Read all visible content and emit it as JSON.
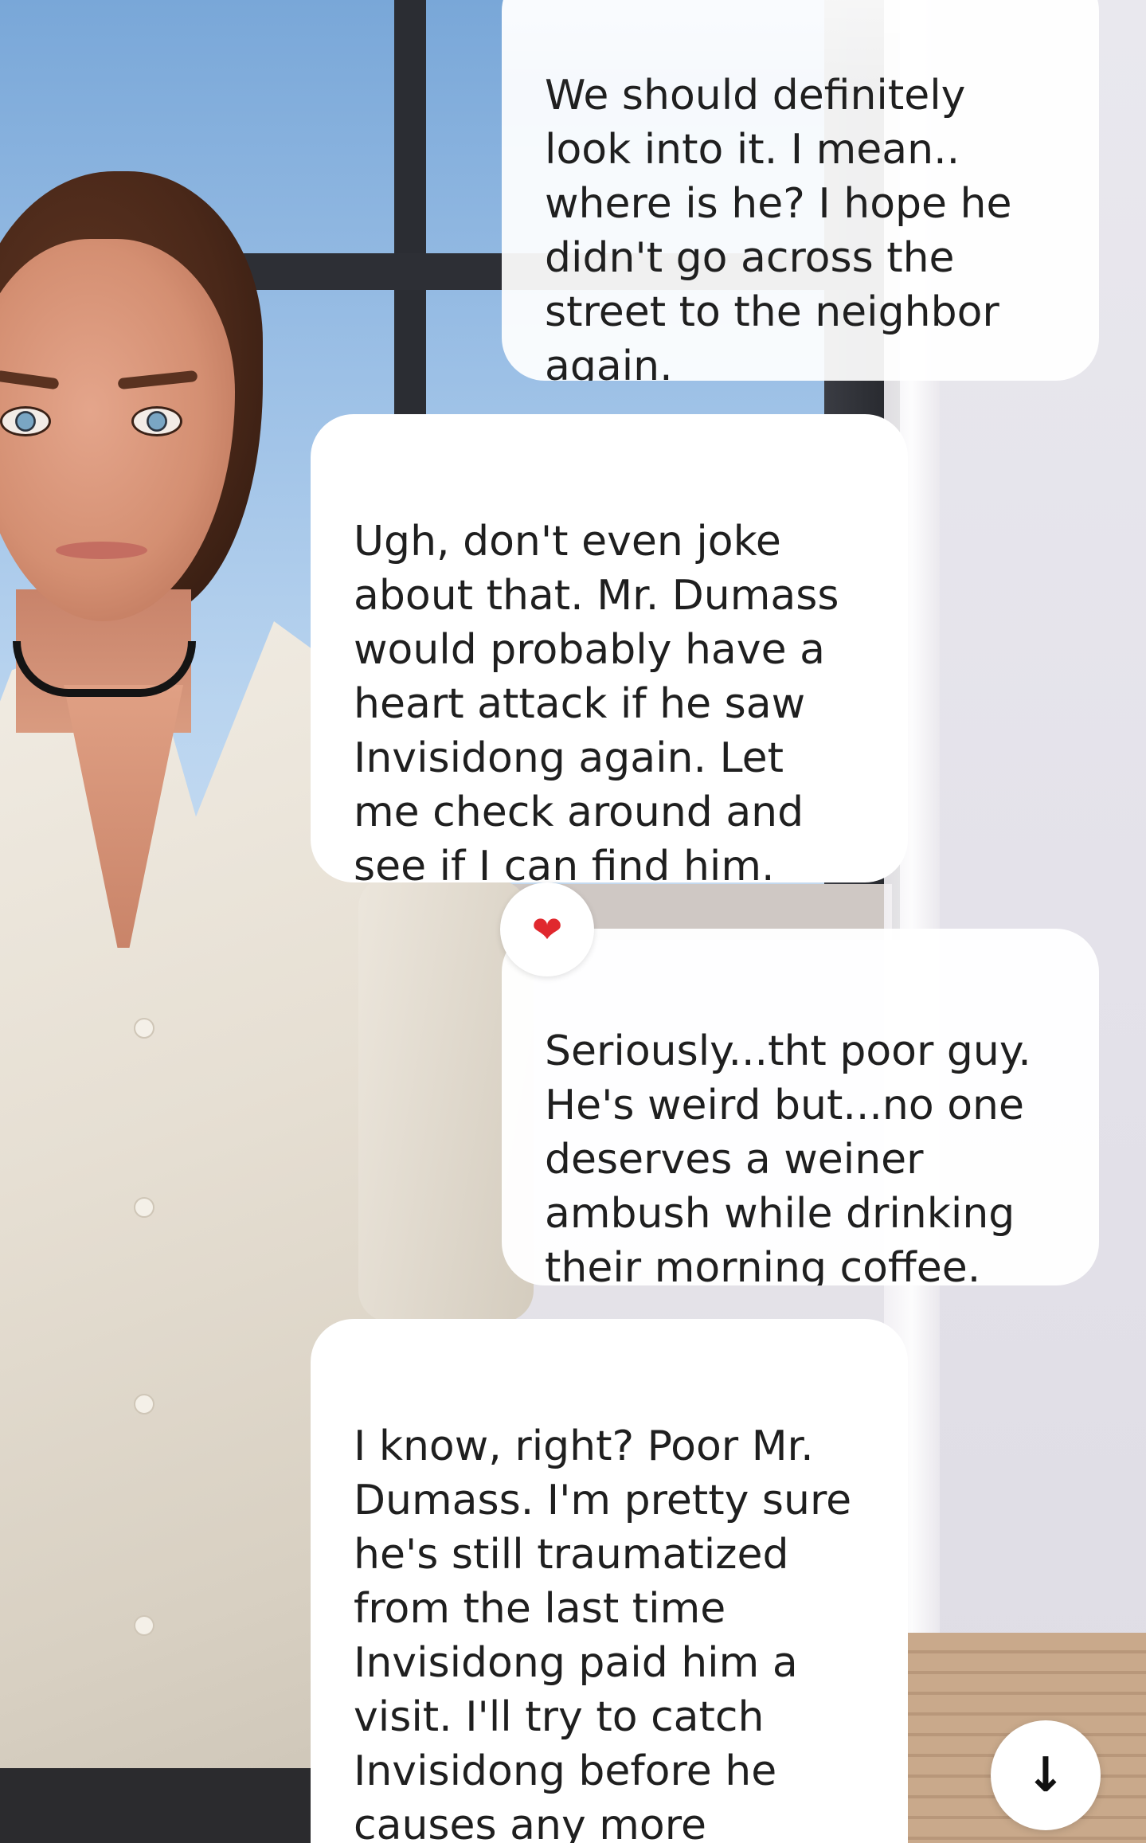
{
  "messages": [
    {
      "sender": "user",
      "text": "We should definitely\nlook into it.  I mean..\nwhere is he? I hope he\ndidn't go across the\nstreet to the neighbor\nagain."
    },
    {
      "sender": "character",
      "text": "Ugh, don't even joke\nabout that. Mr. Dumass\nwould probably have a\nheart attack if he saw\nInvisidong again. Let\nme check around and\nsee if I can find him."
    },
    {
      "sender": "user",
      "text": "Seriously...tht poor guy.\nHe's weird but...no one\ndeserves a weiner\nambush while drinking\ntheir morning coffee.",
      "reaction": "heart"
    },
    {
      "sender": "character",
      "text": "I know, right? Poor Mr.\nDumass. I'm pretty sure\nhe's still traumatized\nfrom the last time\nInvisidong paid him a\nvisit. I'll try to catch\nInvisidong before he\ncauses any more\nchaos."
    }
  ],
  "reaction": {
    "icon": "heart-icon",
    "glyph": "❤",
    "color": "#e0282e"
  },
  "scroll_button": {
    "icon": "arrow-down-icon",
    "glyph": "↓"
  }
}
